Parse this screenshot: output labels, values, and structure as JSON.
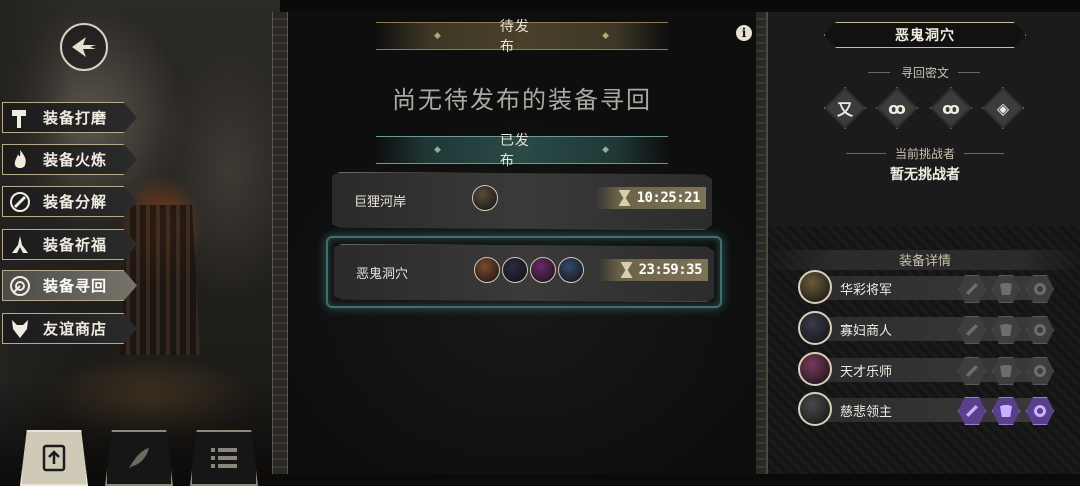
{
  "nav": {
    "back_icon": "back-arrow-icon",
    "items": [
      {
        "label": "装备打磨",
        "icon": "hammer-icon"
      },
      {
        "label": "装备火炼",
        "icon": "flame-icon"
      },
      {
        "label": "装备分解",
        "icon": "disassemble-icon"
      },
      {
        "label": "装备祈福",
        "icon": "pray-icon"
      },
      {
        "label": "装备寻回",
        "icon": "target-icon"
      },
      {
        "label": "友谊商店",
        "icon": "fox-icon"
      }
    ],
    "active_index": 4,
    "bottom_tabs": [
      {
        "icon": "upload-icon",
        "active": true
      },
      {
        "icon": "feather-icon",
        "active": false
      },
      {
        "icon": "list-icon",
        "active": false
      }
    ]
  },
  "center": {
    "pending_title": "待发布",
    "empty_message": "尚无待发布的装备寻回",
    "published_title": "已发布",
    "info_icon_glyph": "i",
    "quests": [
      {
        "name": "巨狸河岸",
        "avatars": [
          "#5a4a3a"
        ],
        "timer": "10:25:21",
        "selected": false
      },
      {
        "name": "恶鬼洞穴",
        "avatars": [
          "#7a4a2a",
          "#2a2a44",
          "#6a2a6a",
          "#344a6a"
        ],
        "timer": "23:59:35",
        "selected": true
      }
    ]
  },
  "detail": {
    "title": "恶鬼洞穴",
    "cipher_label": "寻回密文",
    "runes": [
      "又",
      "ꝏ",
      "ꝏ",
      "◈"
    ],
    "challenger_label": "当前挑战者",
    "challenger_value": "暂无挑战者",
    "equipment_label": "装备详情",
    "equipment": [
      {
        "name": "华彩将军",
        "avatar_color": "#6a5a3a",
        "slots_active": [
          false,
          false,
          false
        ]
      },
      {
        "name": "寡妇商人",
        "avatar_color": "#3a3a4a",
        "slots_active": [
          false,
          false,
          false
        ]
      },
      {
        "name": "天才乐师",
        "avatar_color": "#7a3a5a",
        "slots_active": [
          false,
          false,
          false
        ]
      },
      {
        "name": "慈悲领主",
        "avatar_color": "#4a4a4a",
        "slots_active": [
          true,
          true,
          true
        ]
      }
    ]
  },
  "colors": {
    "accent_gold": "#b8a572",
    "accent_teal": "#4c7e7c",
    "slot_active": "#5a3f8a"
  }
}
